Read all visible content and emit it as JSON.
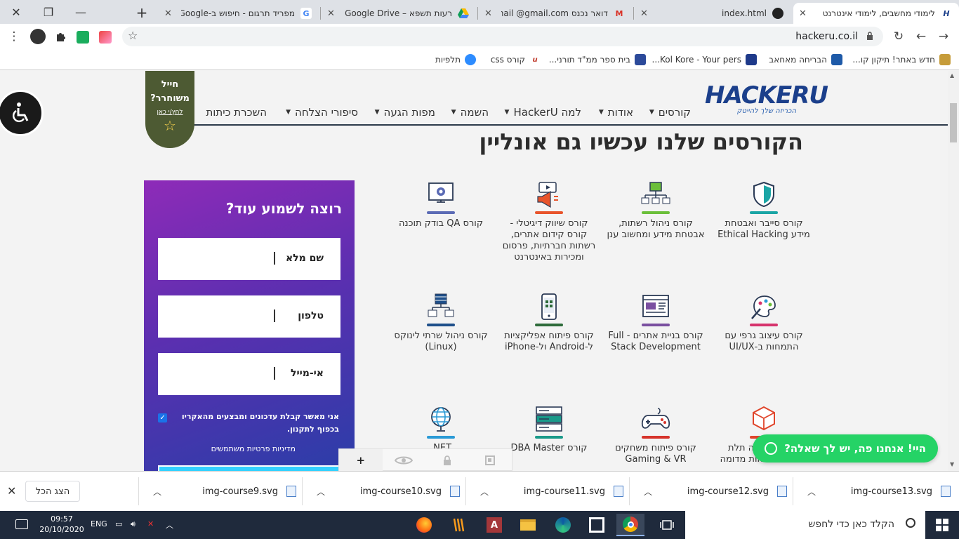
{
  "tabs": [
    {
      "title": "לימודי מחשבים, לימודי אינטרנט",
      "favicon": "hackeru-icon",
      "active": true
    },
    {
      "title": "index.html",
      "favicon": "github-icon"
    },
    {
      "title": "דואר נכנס Gmail @gmail.com",
      "favicon": "gmail-icon"
    },
    {
      "title": "רעות תשפא – Google Drive",
      "favicon": "google-drive-icon"
    },
    {
      "title": "מפריד תרגום - חיפוש ב-Google",
      "favicon": "google-icon"
    }
  ],
  "toolbar": {
    "url": "hackeru.co.il"
  },
  "bookmarks": [
    {
      "label": "חדש באתר! תיקון קו...",
      "icon": "folder-icon",
      "color": "#c69c3a"
    },
    {
      "label": "הבריחה מאחאב",
      "icon": "book-icon",
      "color": "#1e5aa8"
    },
    {
      "label": "Kol Kore - Your pers...",
      "icon": "kolkore-icon",
      "color": "#1e3a8a"
    },
    {
      "label": "בית ספר ממ\"ד תורני...",
      "icon": "school-icon",
      "color": "#2c4a9a"
    },
    {
      "label": "קורס css",
      "icon": "udemy-icon",
      "color": "#c0392b"
    },
    {
      "label": "תלפיות",
      "icon": "zoom-icon",
      "color": "#2d8cff"
    }
  ],
  "page": {
    "logo": {
      "mark": "HACKERU",
      "tagline": "הכריזה שלך להייטק"
    },
    "menu": [
      {
        "label": "קורסים",
        "caret": true
      },
      {
        "label": "אודות",
        "caret": true
      },
      {
        "label": "למה HackerU",
        "caret": true
      },
      {
        "label": "השמה",
        "caret": true
      },
      {
        "label": "מפות הגעה",
        "caret": true
      },
      {
        "label": "סיפורי הצלחה",
        "caret": true
      },
      {
        "label": "השכרת כיתות",
        "caret": false
      }
    ],
    "badge": {
      "line1": "חייל",
      "line2": "משוחרר?",
      "link": "לחץ/י כאן"
    },
    "heading": "הקורסים שלנו עכשיו גם אונליין",
    "courses": [
      {
        "title": "קורס סייבר ואבטחת מידע Ethical Hacking",
        "icon": "shield-icon",
        "color": "#1aa5a5"
      },
      {
        "title": "קורס ניהול רשתות, אבטחת מידע ומחשוב ענן",
        "icon": "network-icon",
        "color": "#6bbf3a"
      },
      {
        "title": "קורס שיווק דיגיטלי - קורס קידום אתרים, רשתות חברתיות, פרסום ומכירות באינטרנט",
        "icon": "megaphone-icon",
        "color": "#e8542b"
      },
      {
        "title": "קורס QA בודק תוכנה",
        "icon": "monitor-gear-icon",
        "color": "#5b6bb5"
      },
      {
        "title": "קורס עיצוב גרפי עם התמחות ב-UI/UX",
        "icon": "palette-icon",
        "color": "#d6336c"
      },
      {
        "title": "קורס בניית אתרים - Full Stack Development",
        "icon": "webdev-icon",
        "color": "#7a4fa0"
      },
      {
        "title": "קורס פיתוח אפליקציות ל-Android ול-iPhone",
        "icon": "smartphone-icon",
        "color": "#2e6b3a"
      },
      {
        "title": "קורס ניהול שרתי לינוקס (Linux)",
        "icon": "servers-icon",
        "color": "#1e4f8a"
      },
      {
        "title": "קורס הדפסה תלת ממדית ומציאות מדומה",
        "icon": "cube-icon",
        "color": "#e0452b"
      },
      {
        "title": "קורס פיתוח משחקים Gaming & VR",
        "icon": "gamepad-icon",
        "color": "#d6332b"
      },
      {
        "title": "קורס DBA Master",
        "icon": "database-icon",
        "color": "#1a9a8a"
      },
      {
        "title": "NET.",
        "icon": "globe-icon",
        "color": "#2a9ad6"
      }
    ],
    "form": {
      "title": "רוצה לשמוע עוד?",
      "fields": [
        "שם מלא",
        "טלפון",
        "אי-מייל"
      ],
      "consent": "אני מאשר קבלת עדכונים ומבצעים מהאקריו בכפוף לתקנון.",
      "consent_checked": true,
      "policy": "מדיניות פרטיות משתמשים"
    },
    "floatbar": [
      "+",
      "eye-icon",
      "lock-icon",
      "window-icon"
    ],
    "whatsapp": "היי! אנחנו פה, יש לך שאלה?"
  },
  "downloads": {
    "items": [
      "img-course13.svg",
      "img-course12.svg",
      "img-course11.svg",
      "img-course10.svg",
      "img-course9.svg"
    ],
    "show_all": "הצג הכל"
  },
  "taskbar": {
    "search_placeholder": "הקלד כאן כדי לחפש",
    "time": "09:57",
    "date": "20/10/2020",
    "lang": "ENG"
  }
}
